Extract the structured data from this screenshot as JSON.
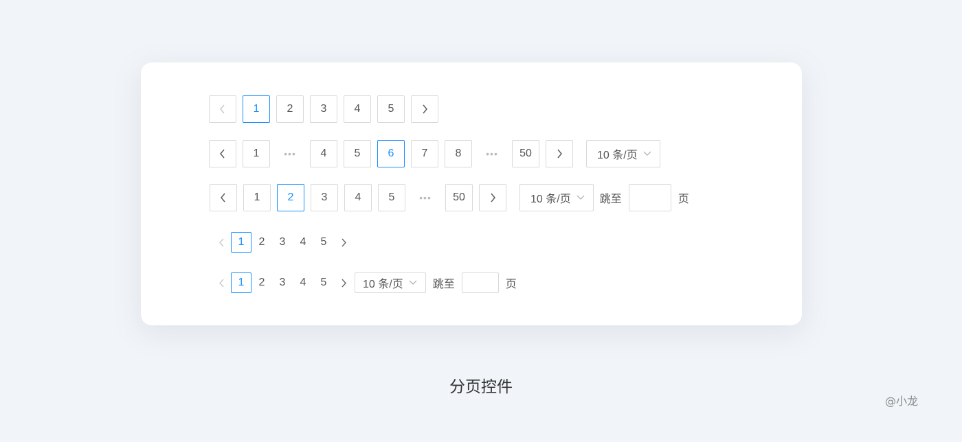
{
  "rows": {
    "row1": {
      "pages": [
        "1",
        "2",
        "3",
        "4",
        "5"
      ],
      "active": "1"
    },
    "row2": {
      "first": "1",
      "ellipsis": "•••",
      "middle": [
        "4",
        "5",
        "6",
        "7",
        "8"
      ],
      "active": "6",
      "last": "50",
      "page_size": "10 条/页"
    },
    "row3": {
      "pages": [
        "1",
        "2",
        "3",
        "4",
        "5"
      ],
      "active": "2",
      "ellipsis": "•••",
      "last": "50",
      "page_size": "10 条/页",
      "jump_label": "跳至",
      "jump_value": "",
      "page_suffix": "页"
    },
    "row4": {
      "pages": [
        "1",
        "2",
        "3",
        "4",
        "5"
      ],
      "active": "1"
    },
    "row5": {
      "pages": [
        "1",
        "2",
        "3",
        "4",
        "5"
      ],
      "active": "1",
      "page_size": "10 条/页",
      "jump_label": "跳至",
      "jump_value": "",
      "page_suffix": "页"
    }
  },
  "icons": {
    "prev": "chevron-left-icon",
    "next": "chevron-right-icon",
    "dropdown": "chevron-down-icon"
  },
  "colors": {
    "accent": "#1890ff",
    "border": "#d9d9d9",
    "background": "#f1f4f8"
  },
  "caption": "分页控件",
  "watermark": "@小龙"
}
